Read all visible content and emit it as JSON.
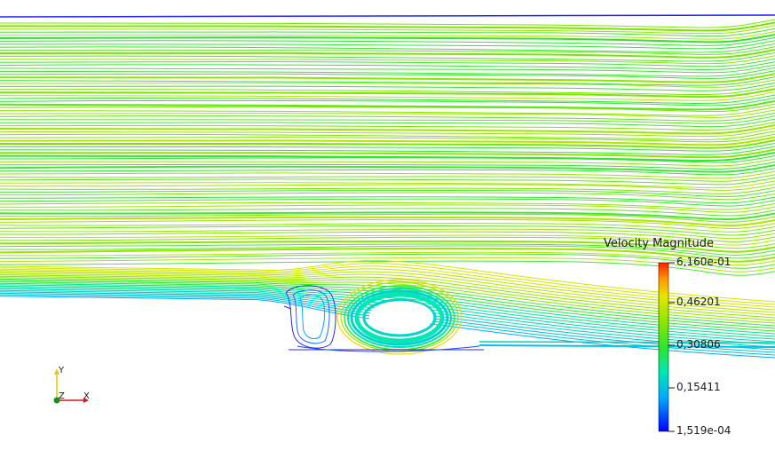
{
  "viewer": {
    "colorbar": {
      "title": "Velocity Magnitude",
      "labels": [
        "6,160e-01",
        "0,46201",
        "0,30806",
        "0,15411",
        "1,519e-04"
      ],
      "colors": [
        "#1a1aff",
        "#00b3ff",
        "#00e6b0",
        "#33e633",
        "#7ae600",
        "#b8e600",
        "#e6e600",
        "#ff9900",
        "#ff2a00"
      ]
    },
    "orientation_axes": {
      "x_label": "X",
      "y_label": "Y",
      "z_label": "Z"
    }
  }
}
